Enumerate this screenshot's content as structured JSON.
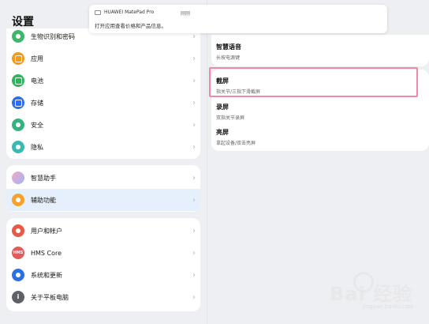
{
  "header": {
    "title": "设置"
  },
  "notification": {
    "app": "HUAWEI MatePad Pro",
    "time": "刚刚",
    "message": "打开应用查看价格和产品信息。"
  },
  "sidebar": {
    "group1": [
      {
        "label": "生物识别和密码",
        "color": "#3fb66a",
        "icon": "key-icon"
      },
      {
        "label": "应用",
        "color": "#f19a1b",
        "icon": "apps-grid-icon"
      },
      {
        "label": "电池",
        "color": "#30b35a",
        "icon": "battery-icon"
      },
      {
        "label": "存储",
        "color": "#2f6ee8",
        "icon": "storage-icon"
      },
      {
        "label": "安全",
        "color": "#35b37f",
        "icon": "shield-icon"
      },
      {
        "label": "隐私",
        "color": "#39b9b0",
        "icon": "privacy-icon"
      }
    ],
    "group2": [
      {
        "label": "智慧助手",
        "color": "#b9a0f0",
        "icon": "assistant-icon"
      },
      {
        "label": "辅助功能",
        "color": "#f5a12a",
        "icon": "accessibility-icon"
      }
    ],
    "group3": [
      {
        "label": "用户和帐户",
        "color": "#e85a45",
        "icon": "user-icon"
      },
      {
        "label": "HMS Core",
        "color": "#e25c5c",
        "icon": "hms-core-icon",
        "badge": "HMS"
      },
      {
        "label": "系统和更新",
        "color": "#2e6ee6",
        "icon": "system-update-icon"
      },
      {
        "label": "关于平板电脑",
        "color": "#5f6168",
        "icon": "info-icon",
        "badge": "i"
      }
    ],
    "chevron": "›"
  },
  "detail": {
    "group1": [
      {
        "title": "智慧语音",
        "subtitle": "长按电源键"
      }
    ],
    "group2": [
      {
        "title": "截屏",
        "subtitle": "指关节/三指下滑截屏"
      },
      {
        "title": "录屏",
        "subtitle": "双指关节录屏"
      },
      {
        "title": "亮屏",
        "subtitle": "拿起设备/双击亮屏"
      }
    ]
  },
  "watermark": {
    "text": "Bai 经验",
    "sub": "jingyan.baidu.com"
  }
}
